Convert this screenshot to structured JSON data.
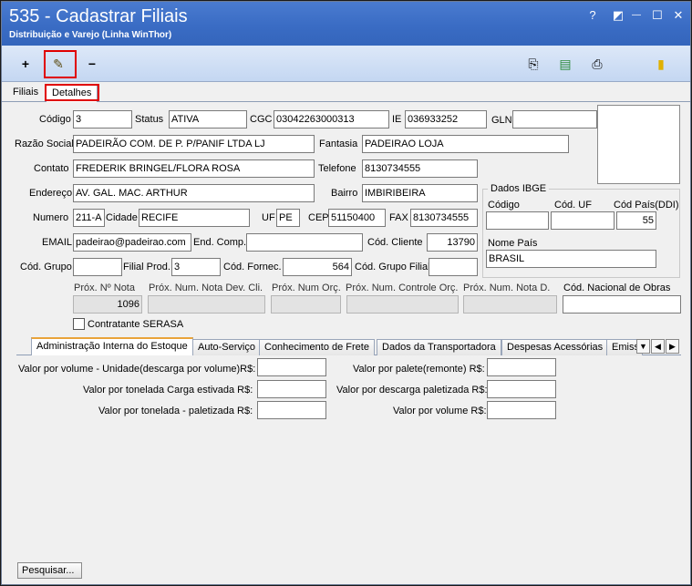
{
  "window": {
    "title": "535 - Cadastrar Filiais",
    "subtitle": "Distribuição e Varejo (Linha WinThor)",
    "help_glyph": "?",
    "restore_glyph": "◩",
    "minimize_glyph": "—",
    "maximize_glyph": "☐",
    "close_glyph": "✕"
  },
  "toolbar": {
    "add_glyph": "+",
    "edit_glyph": "✎",
    "remove_glyph": "−",
    "copy_glyph": "⎘",
    "doc_glyph": "▤",
    "print_glyph": "⎙",
    "exit_glyph": "▮"
  },
  "top_tabs": [
    "Filiais",
    "Detalhes"
  ],
  "form": {
    "codigo_label": "Código",
    "codigo": "3",
    "status_label": "Status",
    "status": "ATIVA",
    "cgc_label": "CGC",
    "cgc": "03042263000313",
    "ie_label": "IE",
    "ie": "036933252",
    "gln_label": "GLN",
    "gln": "",
    "razao_label": "Razão Social",
    "razao": "PADEIRÃO COM. DE P. P/PANIF LTDA LJ",
    "fantasia_label": "Fantasia",
    "fantasia": "PADEIRAO LOJA",
    "contato_label": "Contato",
    "contato": "FREDERIK BRINGEL/FLORA ROSA",
    "telefone_label": "Telefone",
    "telefone": "8130734555",
    "endereco_label": "Endereço",
    "endereco": "AV. GAL. MAC. ARTHUR",
    "bairro_label": "Bairro",
    "bairro": "IMBIRIBEIRA",
    "numero_label": "Numero",
    "numero": "211-A",
    "cidade_label": "Cidade",
    "cidade": "RECIFE",
    "uf_label": "UF",
    "uf": "PE",
    "cep_label": "CEP",
    "cep": "51150400",
    "fax_label": "FAX",
    "fax": "8130734555",
    "email_label": "EMAIL",
    "email": "padeirao@padeirao.com",
    "endcomp_label": "End. Comp.",
    "endcomp": "",
    "codcliente_label": "Cód. Cliente",
    "codcliente": "13790",
    "codgrupo_label": "Cód. Grupo",
    "codgrupo": "",
    "filialprod_label": "Filial Prod.",
    "filialprod": "3",
    "codfornec_label": "Cód. Fornec.",
    "codfornec": "564",
    "codgrupofilial_label": "Cód. Grupo Filial",
    "codgrupofilial": ""
  },
  "ibge": {
    "title": "Dados IBGE",
    "codigo_label": "Código",
    "codigo": "",
    "coduf_label": "Cód. UF",
    "coduf": "",
    "codpais_label": "Cód País(DDI)",
    "codpais": "55",
    "nomepais_label": "Nome País",
    "nomepais": "BRASIL"
  },
  "prox": {
    "nota_label": "Próx. Nº Nota",
    "nota": "1096",
    "notadev_label": "Próx. Num. Nota Dev. Cli.",
    "notadev": "",
    "orc_label": "Próx. Num Orç.",
    "orc": "",
    "controle_label": "Próx. Num. Controle Orç.",
    "controle": "",
    "notad_label": "Próx. Num. Nota D.",
    "notad": "",
    "obras_label": "Cód. Nacional de Obras",
    "obras": ""
  },
  "serasa_label": "Contratante SERASA",
  "bottom_tabs": [
    "Administração Interna do Estoque",
    "Auto-Serviço",
    "Conhecimento de Frete",
    "Dados da Transportadora",
    "Despesas Acessórias",
    "Emiss"
  ],
  "tab_arrow_down": "▼",
  "tab_arrow_left": "◀",
  "tab_arrow_right": "▶",
  "estoque": {
    "vol_unid_label": "Valor por volume - Unidade(descarga por volume)R$:",
    "vol_unid": "",
    "ton_carga_label": "Valor por tonelada Carga estivada R$:",
    "ton_carga": "",
    "ton_palet_label": "Valor por tonelada - paletizada R$:",
    "ton_palet": "",
    "palete_label": "Valor por palete(remonte) R$:",
    "palete": "",
    "desc_palet_label": "Valor por descarga paletizada R$:",
    "desc_palet": "",
    "volume_label": "Valor por volume R$:",
    "volume": ""
  },
  "search_button": "Pesquisar..."
}
